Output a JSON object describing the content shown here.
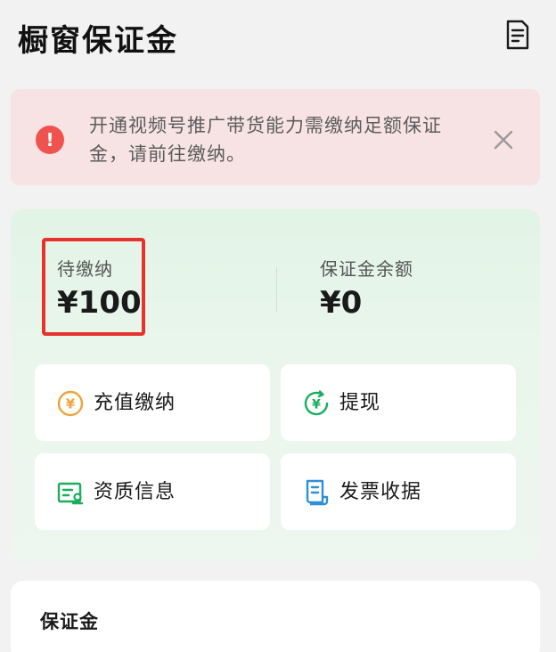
{
  "header": {
    "title": "橱窗保证金",
    "receipt_icon": "receipt-list-icon"
  },
  "alert": {
    "icon": "exclamation-icon",
    "text": "开通视频号推广带货能力需缴纳足额保证金，请前往缴纳。",
    "close_icon": "close-icon",
    "color": "#ef5350"
  },
  "summary": {
    "pending_label": "待缴纳",
    "pending_value": "¥100",
    "balance_label": "保证金余额",
    "balance_value": "¥0"
  },
  "actions": [
    {
      "label": "充值缴纳",
      "icon": "yen-coin-icon",
      "color": "#f0a23b"
    },
    {
      "label": "提现",
      "icon": "yen-withdraw-icon",
      "color": "#1aad5c"
    },
    {
      "label": "资质信息",
      "icon": "certificate-icon",
      "color": "#1aad5c"
    },
    {
      "label": "发票收据",
      "icon": "invoice-icon",
      "color": "#2f8fd8"
    }
  ],
  "bottom": {
    "title": "保证金"
  }
}
